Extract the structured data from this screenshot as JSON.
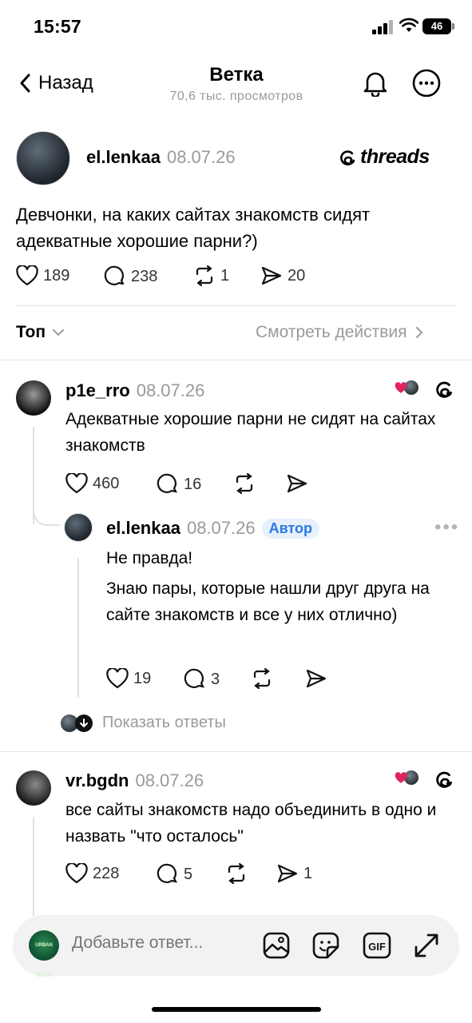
{
  "status_bar": {
    "time": "15:57",
    "battery": "46"
  },
  "nav": {
    "back_label": "Назад",
    "title": "Ветка",
    "subtitle": "70,6 тыс. просмотров"
  },
  "main_post": {
    "username": "el.lenkaa",
    "date": "08.07.26",
    "brand": "threads",
    "text": "Девчонки, на каких сайтах знакомств сидят адекватные хорошие парни?)",
    "likes": "189",
    "comments": "238",
    "reposts": "1",
    "shares": "20"
  },
  "sort": {
    "label": "Топ",
    "view_actions": "Смотреть действия"
  },
  "replies": [
    {
      "username": "p1e_rro",
      "date": "08.07.26",
      "text": "Адекватные хорошие парни не сидят на сайтах знакомств",
      "likes": "460",
      "comments": "16",
      "nested": {
        "username": "el.lenkaa",
        "date": "08.07.26",
        "badge": "Автор",
        "text_lines": [
          "Не правда!",
          "Знаю пары, которые нашли друг друга на сайте знакомств и все у них отлично)"
        ],
        "likes": "19",
        "comments": "3"
      },
      "show_replies": "Показать ответы"
    },
    {
      "username": "vr.bgdn",
      "date": "08.07.26",
      "text": "все сайты знакомств надо объединить в одно и назвать \"что осталось\"",
      "likes": "228",
      "comments": "5",
      "shares": "1"
    }
  ],
  "composer": {
    "placeholder": "Добавьте ответ...",
    "avatar_text": "URBAN SPACE"
  },
  "colors": {
    "accent": "#2a7ae2",
    "muted": "#9a9a9a",
    "heart": "#e0245e"
  }
}
